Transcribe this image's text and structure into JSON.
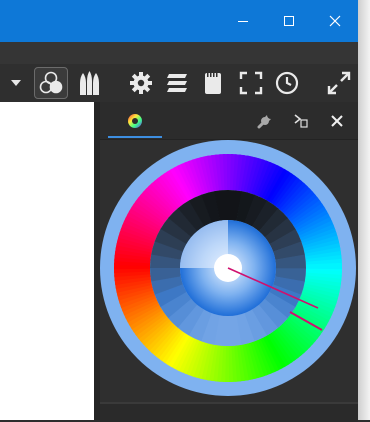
{
  "window": {
    "controls": [
      "minimize",
      "maximize",
      "close"
    ]
  },
  "toolbar": {
    "items": [
      {
        "name": "dropdown-arrow-icon"
      },
      {
        "name": "color-selectors-icon",
        "active": true
      },
      {
        "name": "brush-presets-icon"
      },
      {
        "name": "gear-icon"
      },
      {
        "name": "layers-icon"
      },
      {
        "name": "memory-card-icon"
      },
      {
        "name": "fullscreen-icon"
      },
      {
        "name": "clock-icon"
      },
      {
        "name": "expand-arrows-icon"
      }
    ]
  },
  "docker": {
    "tabs": [
      {
        "name": "advanced-color-selector-tab",
        "active": true
      }
    ],
    "buttons": [
      "wrench-icon",
      "float-docker-icon",
      "close-docker-icon"
    ]
  },
  "color_selector": {
    "outer_ring_color": "#7fb2f0",
    "selected_hue_color": "#2d7ff4",
    "background": "#2f2f2f"
  },
  "colors": {
    "titlebar": "#0e78d7",
    "toolbar": "#2f2f2f",
    "docker": "#333333",
    "canvas": "#ffffff",
    "accent": "#3d8ee0"
  }
}
